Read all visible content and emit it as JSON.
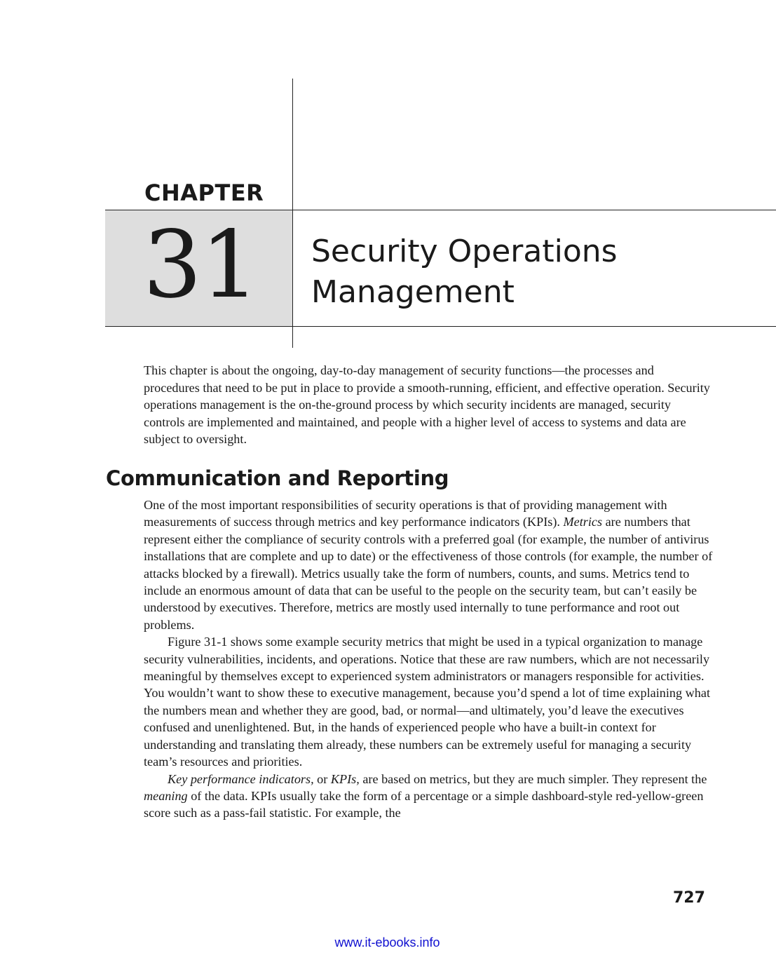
{
  "chapter": {
    "label": "CHAPTER",
    "number": "31",
    "title_line1": "Security Operations",
    "title_line2": "Management"
  },
  "intro_paragraph": "This chapter is about the ongoing, day-to-day management of security functions—the processes and procedures that need to be put in place to provide a smooth-running, efficient, and effective operation. Security operations management is the on-the-ground process by which security incidents are managed, security controls are implemented and maintained, and people with a higher level of access to systems and data are subject to oversight.",
  "section": {
    "heading": "Communication and Reporting",
    "p1_part1": "One of the most important responsibilities of security operations is that of providing management with measurements of success through metrics and key performance indicators (KPIs). ",
    "p1_italic": "Metrics",
    "p1_part2": " are numbers that represent either the compliance of security controls with a preferred goal (for example, the number of antivirus installations that are complete and up to date) or the effectiveness of those controls (for example, the number of attacks blocked by a firewall). Metrics usually take the form of numbers, counts, and sums. Metrics tend to include an enormous amount of data that can be useful to the people on the security team, but can’t easily be understood by executives. Therefore, metrics are mostly used internally to tune performance and root out problems.",
    "p2": "Figure 31-1 shows some example security metrics that might be used in a typical organization to manage security vulnerabilities, incidents, and operations. Notice that these are raw numbers, which are not necessarily meaningful by themselves except to experienced system administrators or managers responsible for activities. You wouldn’t want to show these to executive management, because you’d spend a lot of time explaining what the numbers mean and whether they are good, bad, or normal—and ultimately, you’d leave the executives confused and unenlightened. But, in the hands of experienced people who have a built-in context for understanding and translating them already, these numbers can be extremely useful for managing a security team’s resources and priorities.",
    "p3_italic1": "Key performance indicators,",
    "p3_part1": " or ",
    "p3_italic2": "KPIs,",
    "p3_part2": " are based on metrics, but they are much simpler. They represent the ",
    "p3_italic3": "meaning",
    "p3_part3": " of the data. KPIs usually take the form of a percentage or a simple dashboard-style red-yellow-green score such as a pass-fail statistic. For example, the"
  },
  "page_number": "727",
  "footer_link": "www.it-ebooks.info"
}
